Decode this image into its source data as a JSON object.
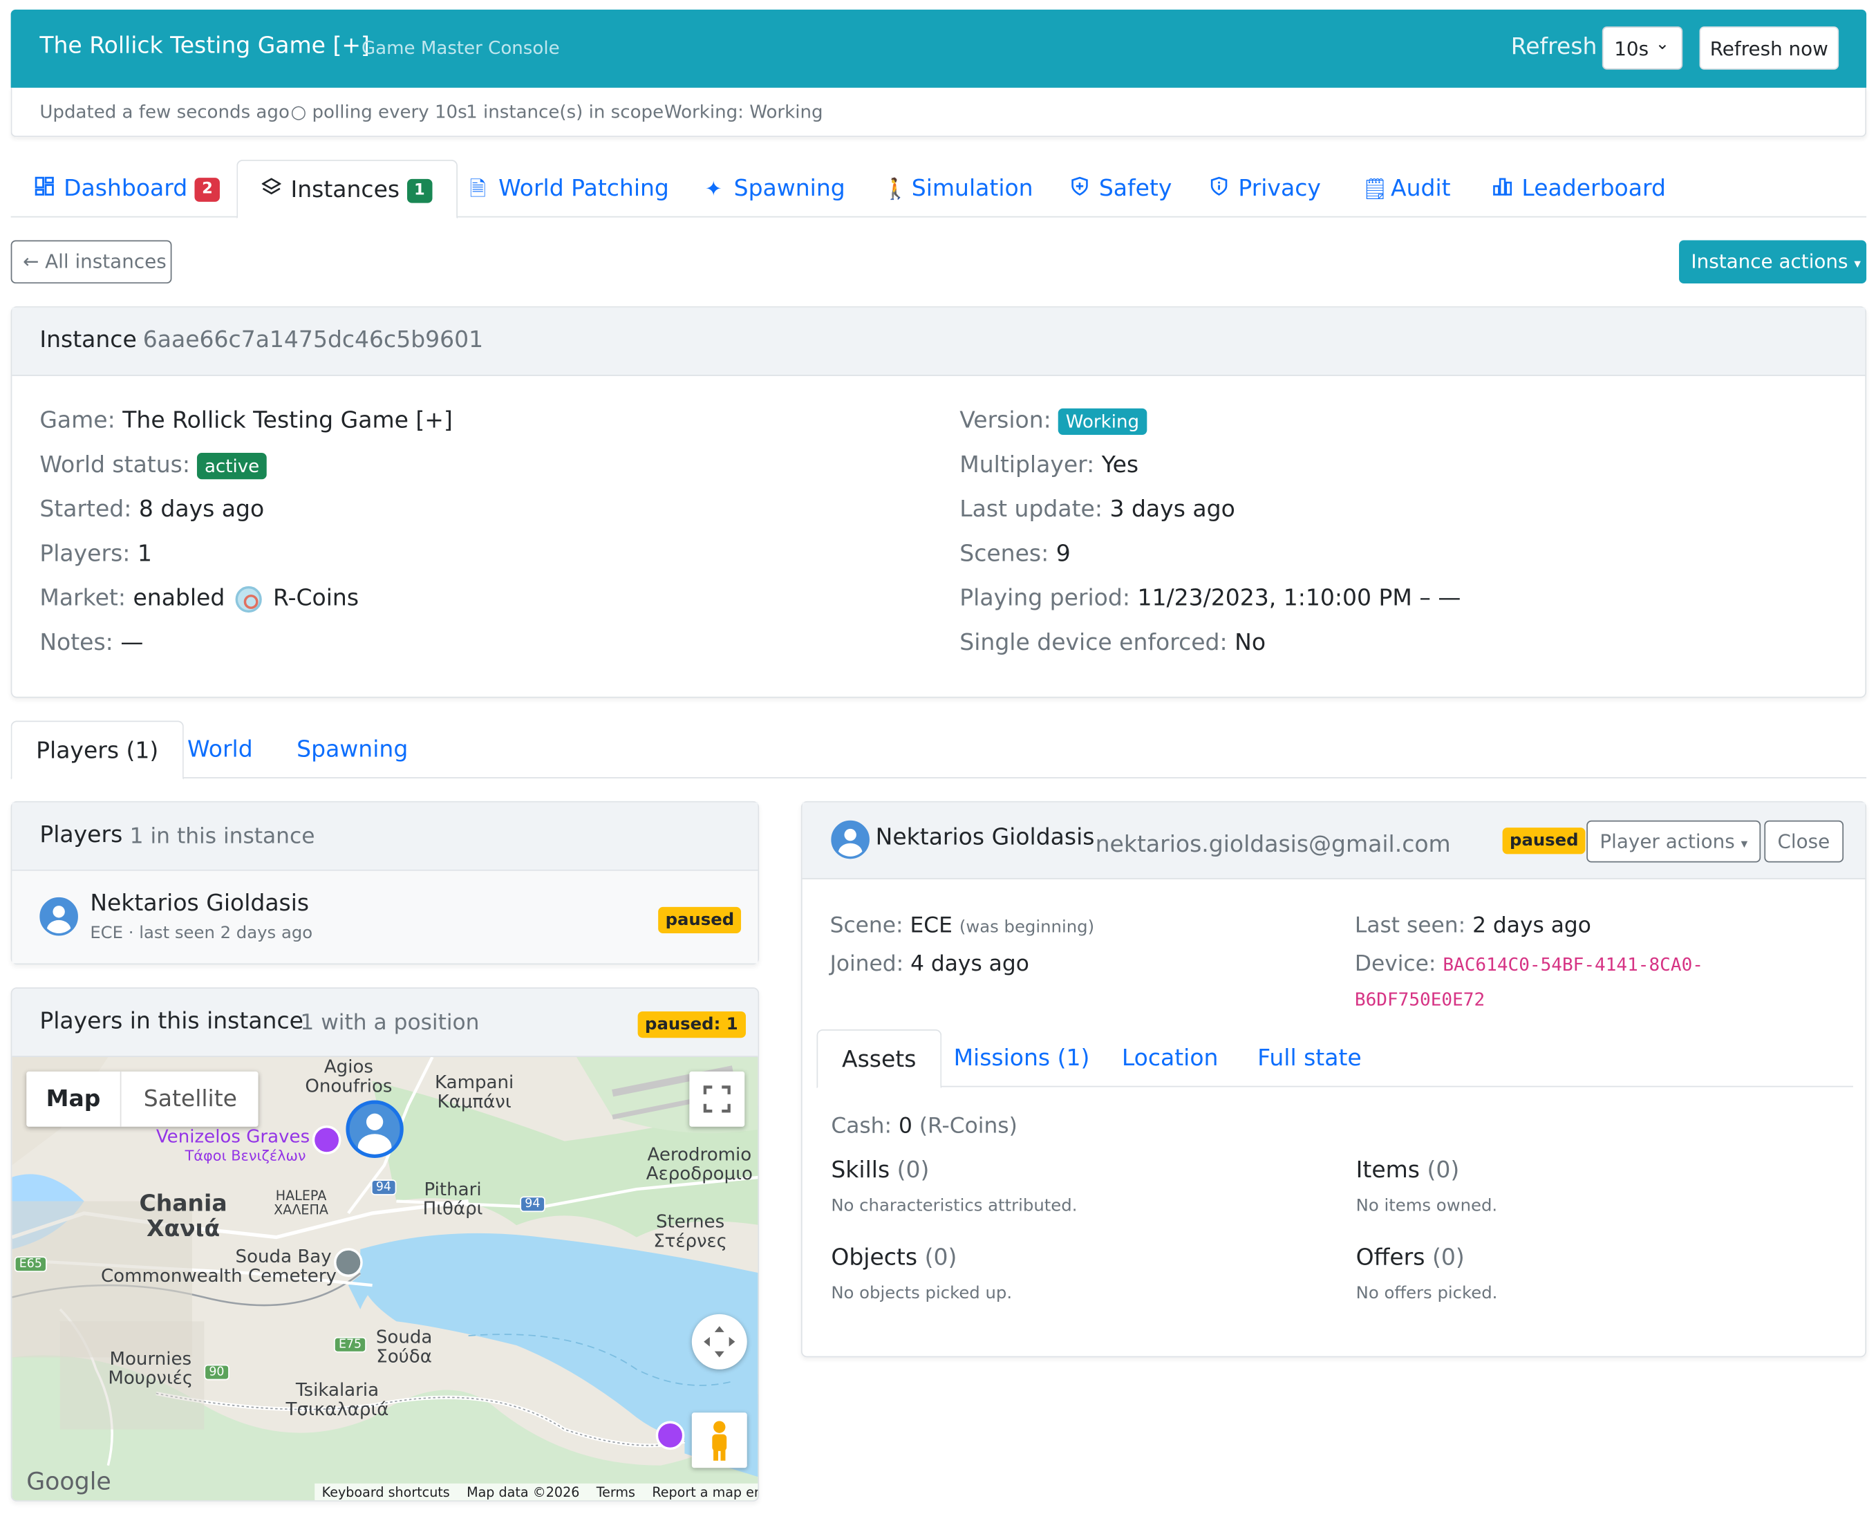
{
  "header": {
    "title": "The Rollick Testing Game [+]",
    "subtitle": "Game Master Console",
    "refresh_label": "Refresh",
    "refresh_interval": "10s",
    "refresh_now": "Refresh now",
    "accent": "#17a2b8"
  },
  "status_bar": {
    "updated": "Updated a few seconds ago",
    "polling": "○ polling every 10s",
    "scope": "1 instance(s) in scope",
    "working": "Working: Working"
  },
  "tabs": [
    {
      "label": "Dashboard",
      "icon": "dashboard-icon",
      "badge": "2"
    },
    {
      "label": "Instances",
      "icon": "layers-icon",
      "badge": "1"
    },
    {
      "label": "World Patching",
      "icon": "document-icon"
    },
    {
      "label": "Spawning",
      "icon": "sparkles-icon"
    },
    {
      "label": "Simulation",
      "icon": "walking-icon"
    },
    {
      "label": "Safety",
      "icon": "shield-icon"
    },
    {
      "label": "Privacy",
      "icon": "shield-info-icon"
    },
    {
      "label": "Audit",
      "icon": "journal-icon"
    },
    {
      "label": "Leaderboard",
      "icon": "bar-chart-icon"
    }
  ],
  "actions": {
    "all_instances": "← All instances",
    "instance_actions": "Instance actions"
  },
  "instance": {
    "label": "Instance",
    "id": "6aae66c7a1475dc46c5b9601",
    "left": {
      "game_k": "Game:",
      "game_v": "The Rollick Testing Game [+]",
      "world_k": "World status:",
      "world_v": "active",
      "started_k": "Started:",
      "started_v": "8 days ago",
      "players_k": "Players:",
      "players_v": "1",
      "market_k": "Market:",
      "market_v": "enabled",
      "market_coin": "R-Coins",
      "notes_k": "Notes:",
      "notes_v": "—"
    },
    "right": {
      "version_k": "Version:",
      "version_v": "Working",
      "multi_k": "Multiplayer:",
      "multi_v": "Yes",
      "update_k": "Last update:",
      "update_v": "3 days ago",
      "scenes_k": "Scenes:",
      "scenes_v": "9",
      "period_k": "Playing period:",
      "period_v": "11/23/2023, 1:10:00 PM – —",
      "single_k": "Single device enforced:",
      "single_v": "No"
    }
  },
  "subtabs": [
    "Players (1)",
    "World",
    "Spawning"
  ],
  "players_card": {
    "title": "Players",
    "subtitle": "1 in this instance",
    "player_name": "Nektarios Gioldasis",
    "player_meta": "ECE · last seen 2 days ago",
    "status": "paused"
  },
  "map_card": {
    "title": "Players in this instance",
    "subtitle": "1 with a position",
    "badge": "paused: 1",
    "map_btn": "Map",
    "satellite_btn": "Satellite",
    "labels": {
      "agios": "Agios\nOnoufrios",
      "kampani": "Kampani\nΚαμπάνι",
      "venizelos": "Venizelos Graves",
      "venizelos_gr": "Τάφοι Βενιζέλων",
      "chania": "Chania\nΧανιά",
      "halepa": "HALEPA\nΧΑΛΕΠΑ",
      "pithari": "Pithari\nΠιθάρι",
      "aerodromio": "Aerodromio\nΑεροδρομιο",
      "sternes": "Sternes\nΣτέρνες",
      "souda_bay": "Souda Bay",
      "cemetery": "Commonwealth Cemetery",
      "souda": "Souda\nΣούδα",
      "mournies": "Mournies\nΜουρνιές",
      "tsikalaria": "Tsikalaria\nΤσικαλαριά",
      "road94a": "94",
      "road94b": "94",
      "road90": "90",
      "e75": "E75",
      "e65": "E65"
    },
    "google": "Google",
    "footer": {
      "shortcuts": "Keyboard shortcuts",
      "mapdata": "Map data ©2026",
      "terms": "Terms",
      "report": "Report a map error"
    }
  },
  "detail": {
    "name": "Nektarios Gioldasis",
    "email": "nektarios.gioldasis@gmail.com",
    "status": "paused",
    "player_actions": "Player actions",
    "close": "Close",
    "scene_k": "Scene:",
    "scene_v": "ECE",
    "scene_note": "(was beginning)",
    "joined_k": "Joined:",
    "joined_v": "4 days ago",
    "seen_k": "Last seen:",
    "seen_v": "2 days ago",
    "device_k": "Device:",
    "device_v1": "BAC614C0-54BF-4141-8CA0-",
    "device_v2": "B6DF750E0E72",
    "tabs": [
      "Assets",
      "Missions (1)",
      "Location",
      "Full state"
    ],
    "cash_k": "Cash:",
    "cash_v": "0",
    "cash_unit": "(R-Coins)",
    "skills": "Skills",
    "skills_n": "(0)",
    "skills_empty": "No characteristics attributed.",
    "items": "Items",
    "items_n": "(0)",
    "items_empty": "No items owned.",
    "objects": "Objects",
    "objects_n": "(0)",
    "objects_empty": "No objects picked up.",
    "offers": "Offers",
    "offers_n": "(0)",
    "offers_empty": "No offers picked."
  }
}
